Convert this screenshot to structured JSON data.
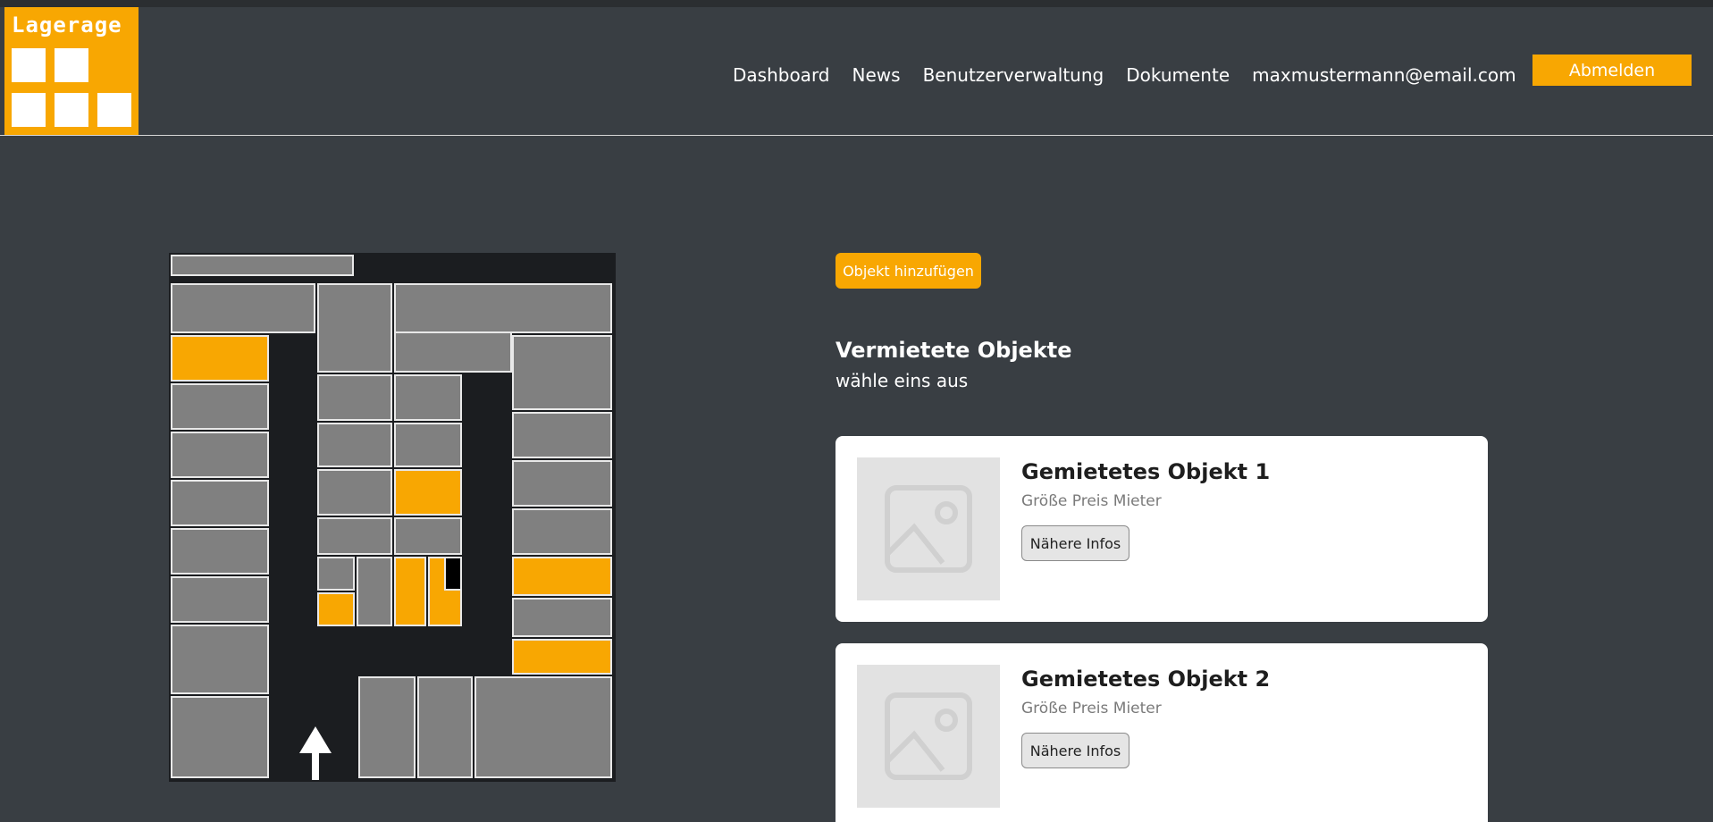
{
  "brand": {
    "logo_text": "Lagerage"
  },
  "nav": {
    "items": [
      "Dashboard",
      "News",
      "Benutzerverwaltung",
      "Dokumente"
    ],
    "user_email": "maxmustermann@email.com",
    "logout_label": "Abmelden"
  },
  "colors": {
    "accent": "#f8a702",
    "background": "#393e43",
    "unit": "#808080",
    "map_floor": "#1b1d20"
  },
  "main": {
    "add_button": "Objekt hinzufügen",
    "section_title": "Vermietete Objekte",
    "section_subtitle": "wähle eins aus",
    "cards": [
      {
        "title": "Gemietetes Objekt 1",
        "meta": "Größe Preis Mieter",
        "button": "Nähere Infos",
        "image_icon": "image-placeholder-icon"
      },
      {
        "title": "Gemietetes Objekt 2",
        "meta": "Größe Preis Mieter",
        "button": "Nähere Infos",
        "image_icon": "image-placeholder-icon"
      }
    ]
  }
}
